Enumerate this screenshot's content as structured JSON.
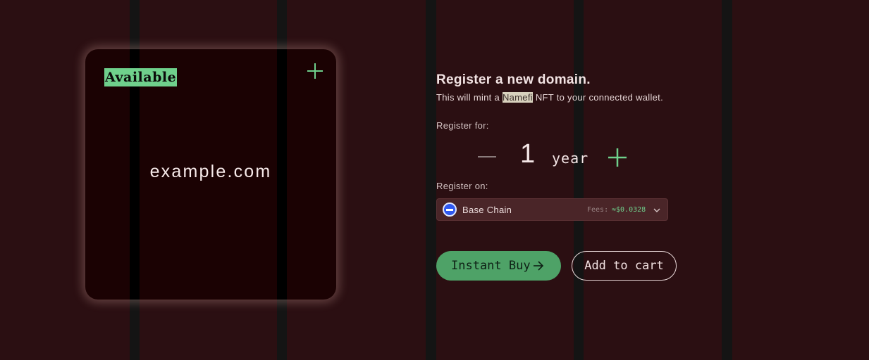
{
  "card": {
    "status": "Available",
    "domain": "example.com"
  },
  "register": {
    "title": "Register a new domain.",
    "subtitle_before": "This will mint a ",
    "subtitle_highlight": "Namefi",
    "subtitle_after": " NFT to your connected wallet.",
    "register_for_label": "Register for:",
    "years": "1",
    "year_unit": "year",
    "register_on_label": "Register on:"
  },
  "chain": {
    "name": "Base Chain",
    "fees_label": "Fees:",
    "fees_value": "≈$0.0328"
  },
  "actions": {
    "instant_buy": "Instant Buy",
    "add_to_cart": "Add to cart"
  },
  "icons": {
    "card_plus": "plus-icon",
    "decrement": "minus-icon",
    "increment": "plus-icon",
    "chain_logo": "base-chain-icon",
    "dropdown": "chevron-down-icon",
    "buy_arrow": "arrow-right-icon"
  },
  "colors": {
    "background": "#2b0f12",
    "accent_green": "#6fd08c",
    "button_green": "#4ea267",
    "card_bg": "#1b0203"
  }
}
